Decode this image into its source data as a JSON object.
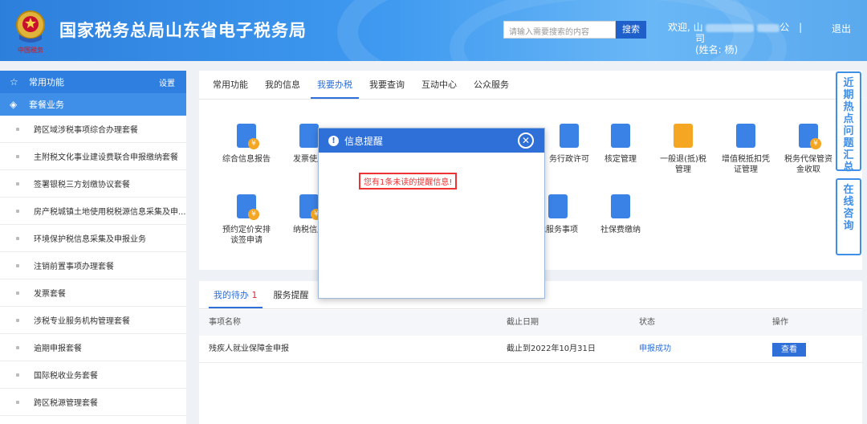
{
  "header": {
    "site_title": "国家税务总局山东省电子税务局",
    "emblem_caption": "中国税务",
    "search_placeholder": "请输入需要搜索的内容",
    "search_button": "搜索",
    "welcome_prefix": "欢迎, 山",
    "welcome_mid": "公",
    "welcome_line2": "司",
    "welcome_name": "(姓名: 杨)",
    "logout": "退出"
  },
  "sidebar": {
    "common": "常用功能",
    "setting": "设置",
    "packages": "套餐业务",
    "items": [
      "跨区域涉税事项综合办理套餐",
      "主附税文化事业建设费联合申报缴纳套餐",
      "签署银税三方划缴协议套餐",
      "房产税城镇土地使用税税源信息采集及申...",
      "环境保护税信息采集及申报业务",
      "注销前置事项办理套餐",
      "发票套餐",
      "涉税专业服务机构管理套餐",
      "逾期申报套餐",
      "国际税收业务套餐",
      "跨区税源管理套餐"
    ]
  },
  "tabs": [
    "常用功能",
    "我的信息",
    "我要办税",
    "我要查询",
    "互动中心",
    "公众服务"
  ],
  "functions": [
    {
      "label": "综合信息报告",
      "icon": "document-icon",
      "color": "#3b82e6"
    },
    {
      "label": "发票使用",
      "icon": "star-folder-icon",
      "color": "#3b82e6"
    },
    {
      "label": "务行政许可",
      "icon": "license-icon",
      "color": "#3b82e6"
    },
    {
      "label": "核定管理",
      "icon": "folder-user-icon",
      "color": "#3b82e6"
    },
    {
      "label": "一般退(抵)税管理",
      "icon": "refund-hand-icon",
      "color": "#f5a623"
    },
    {
      "label": "增值税抵扣凭证管理",
      "icon": "voucher-icon",
      "color": "#3b82e6"
    },
    {
      "label": "税务代保管资金收取",
      "icon": "funds-icon",
      "color": "#3b82e6"
    },
    {
      "label": "预约定价安排谈签申请",
      "icon": "chart-icon",
      "color": "#3b82e6"
    },
    {
      "label": "纳税信用",
      "icon": "thumb-icon",
      "color": "#3b82e6"
    },
    {
      "label": "他服务事项",
      "icon": "grid-icon",
      "color": "#3b82e6"
    },
    {
      "label": "社保费缴纳",
      "icon": "globe-hand-icon",
      "color": "#3b82e6"
    }
  ],
  "float_tabs": {
    "faq": "近期热点问题汇总",
    "consult": "在线咨询"
  },
  "bottom_tabs": {
    "todo": "我的待办",
    "todo_count": "1",
    "remind": "服务提醒"
  },
  "table": {
    "headers": [
      "事项名称",
      "截止日期",
      "状态",
      "操作"
    ],
    "rows": [
      {
        "name": "残疾人就业保障金申报",
        "deadline": "截止到2022年10月31日",
        "status": "申报成功",
        "action": "查看"
      }
    ]
  },
  "modal": {
    "title": "信息提醒",
    "message": "您有1条未读的提醒信息!"
  },
  "colors": {
    "primary": "#2f6fd8",
    "header_gradient_start": "#2d7fdc",
    "alert_red": "#e33333"
  }
}
